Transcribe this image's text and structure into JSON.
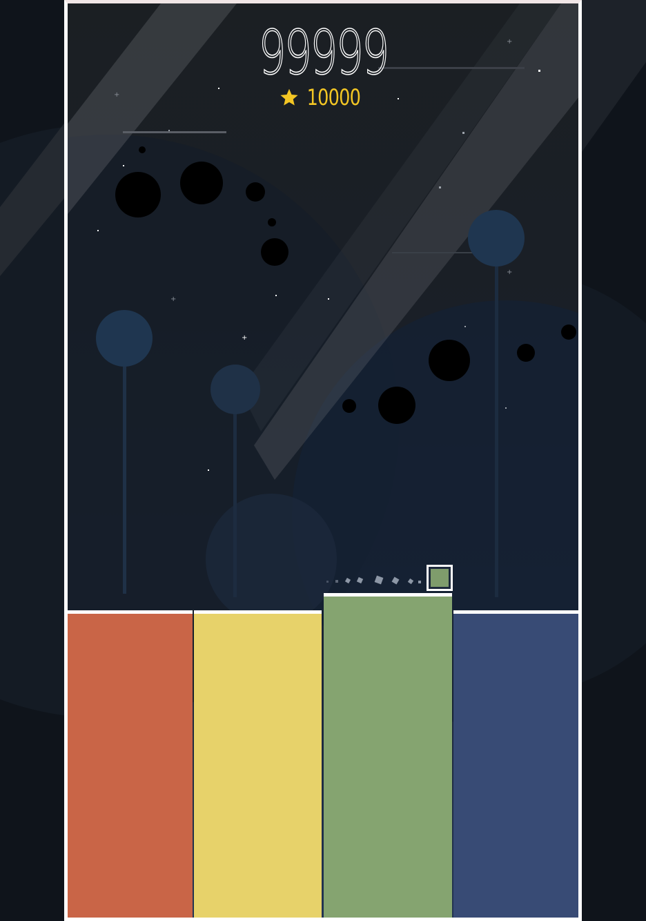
{
  "game": {
    "score": "99999",
    "best_score": "10000",
    "colors": {
      "score_text": "#ffffff",
      "best_score": "#f3c624",
      "pillar_red": "#c96547",
      "pillar_yellow": "#e7d26a",
      "pillar_green": "#85a470",
      "pillar_blue": "#384b75",
      "player_fill": "#7f9c6c"
    },
    "icons": {
      "best": "star-icon"
    }
  }
}
